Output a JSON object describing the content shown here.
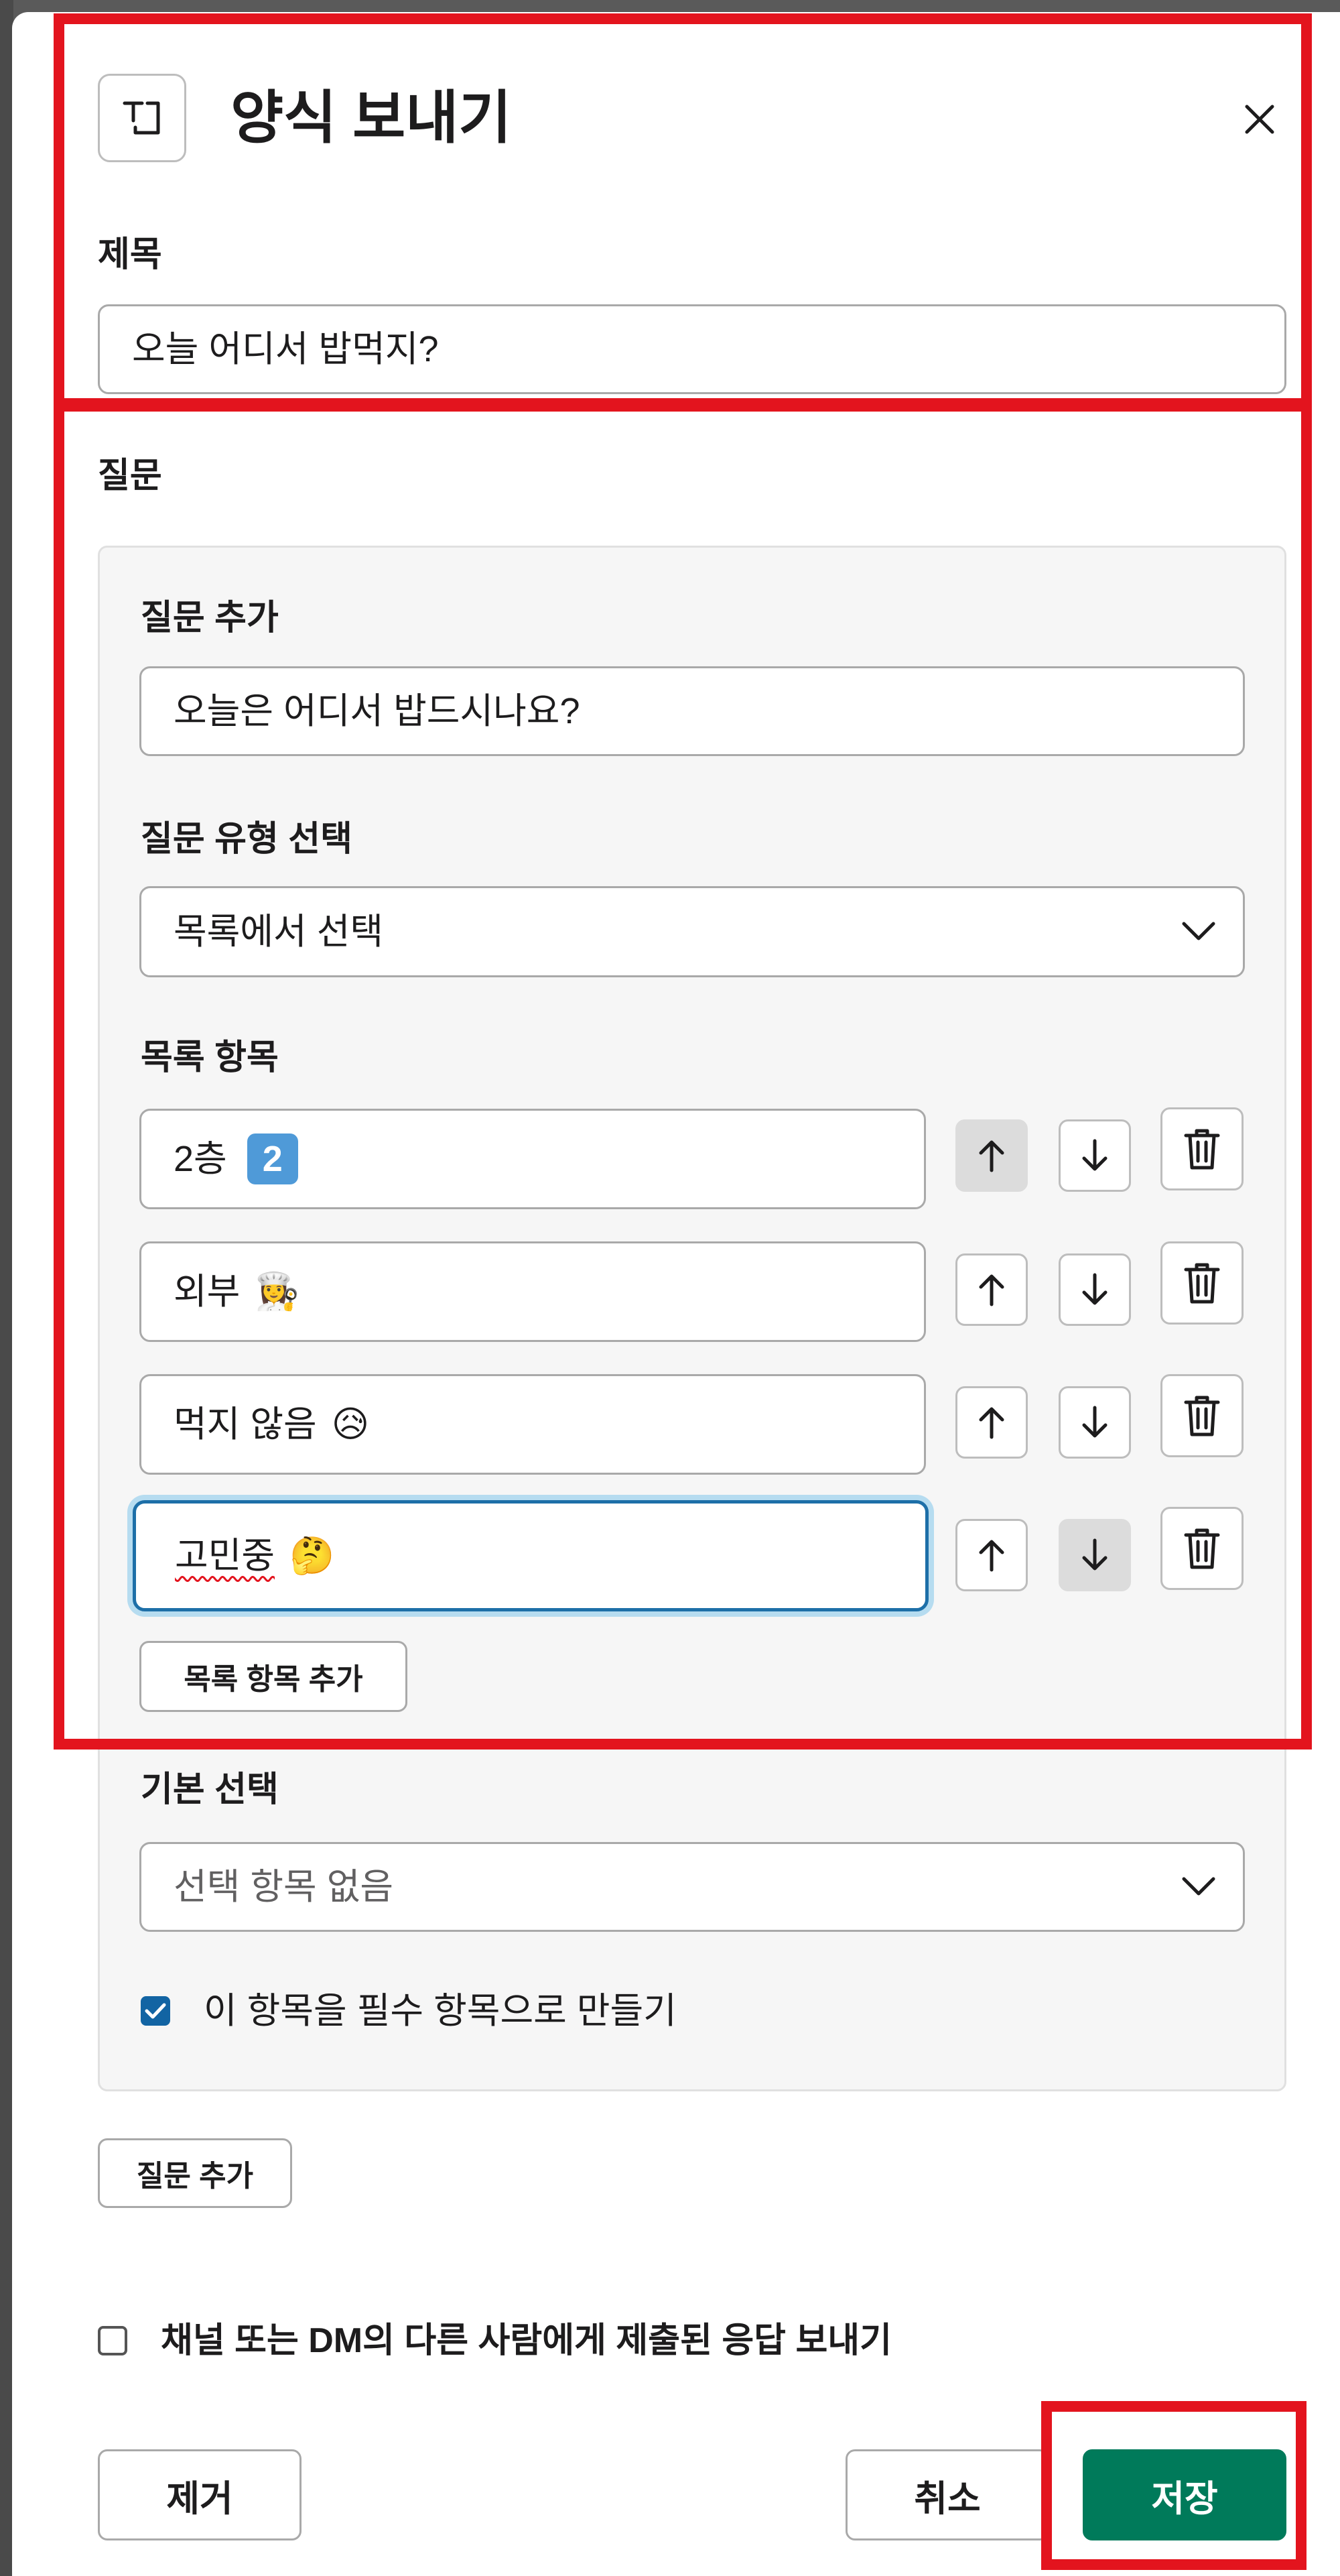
{
  "modal": {
    "title": "양식 보내기",
    "close_icon": "close-icon",
    "header_icon": "text-field-icon"
  },
  "subject": {
    "label": "제목",
    "value": "오늘 어디서 밥먹지?"
  },
  "questions": {
    "label": "질문",
    "add_question_label": "질문 추가",
    "add_question_value": "오늘은 어디서 밥드시나요?",
    "type_label": "질문 유형 선택",
    "type_value": "목록에서 선택",
    "list_label": "목록 항목",
    "items": [
      {
        "text": "2층",
        "emoji": "2"
      },
      {
        "text": "외부",
        "emoji": "👩‍🍳"
      },
      {
        "text": "먹지 않음",
        "emoji": "😥"
      },
      {
        "text": "고민중",
        "emoji": "🤔"
      }
    ],
    "add_list_item_button": "목록 항목 추가",
    "default_label": "기본 선택",
    "default_value": "선택 항목 없음",
    "required_label": "이 항목을 필수 항목으로 만들기",
    "required_checked": true
  },
  "add_question_button": "질문 추가",
  "share_responses_label": "채널 또는 DM의 다른 사람에게 제출된 응답 보내기",
  "share_responses_checked": false,
  "footer": {
    "remove": "제거",
    "cancel": "취소",
    "save": "저장"
  },
  "colors": {
    "primary": "#007a5a",
    "highlight": "#e3141e",
    "focus": "#1d9bd1"
  }
}
